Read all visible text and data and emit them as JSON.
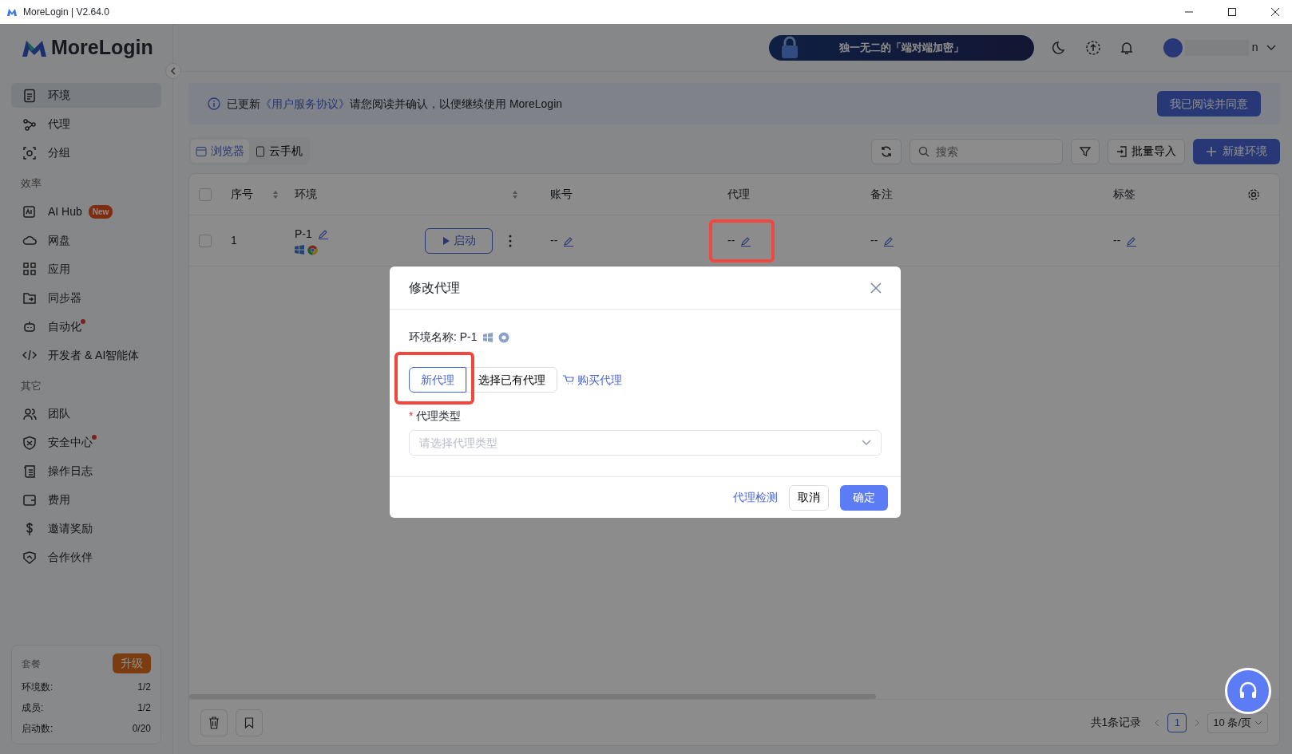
{
  "window": {
    "title": "MoreLogin | V2.64.0"
  },
  "sidebar": {
    "logo": "MoreLogin",
    "sections": [
      {
        "items": [
          {
            "label": "环境",
            "selected": true,
            "dot": false
          },
          {
            "label": "代理",
            "selected": false,
            "dot": false
          },
          {
            "label": "分组",
            "selected": false,
            "dot": false
          }
        ]
      },
      {
        "heading": "效率",
        "items": [
          {
            "label": "AI Hub",
            "selected": false,
            "dot": false,
            "badge": "New"
          },
          {
            "label": "网盘",
            "selected": false,
            "dot": false
          },
          {
            "label": "应用",
            "selected": false,
            "dot": false
          },
          {
            "label": "同步器",
            "selected": false,
            "dot": false
          },
          {
            "label": "自动化",
            "selected": false,
            "dot": true
          },
          {
            "label": "开发者 & AI智能体",
            "selected": false,
            "dot": false
          }
        ]
      },
      {
        "heading": "其它",
        "items": [
          {
            "label": "团队",
            "selected": false,
            "dot": false
          },
          {
            "label": "安全中心",
            "selected": false,
            "dot": true
          },
          {
            "label": "操作日志",
            "selected": false,
            "dot": false
          },
          {
            "label": "费用",
            "selected": false,
            "dot": false
          },
          {
            "label": "邀请奖励",
            "selected": false,
            "dot": false
          },
          {
            "label": "合作伙伴",
            "selected": false,
            "dot": false
          }
        ]
      }
    ],
    "plan": {
      "title": "套餐",
      "upgrade": "升级",
      "rows": [
        {
          "label": "环境数:",
          "value": "1/2"
        },
        {
          "label": "成员:",
          "value": "1/2"
        },
        {
          "label": "启动数:",
          "value": "0/20"
        }
      ]
    }
  },
  "header": {
    "banner": "独一无二的「端对端加密」",
    "user": "n"
  },
  "notice": {
    "text": "已更新",
    "link": "《用户服务协议》",
    "rest": "请您阅读并确认，以便继续使用 MoreLogin",
    "button": "我已阅读并同意"
  },
  "view_tabs": [
    {
      "label": "浏览器",
      "selected": true
    },
    {
      "label": "云手机",
      "selected": false
    }
  ],
  "toolbar": {
    "search": {
      "placeholder": "搜索"
    },
    "import": "批量导入",
    "create": "新建环境"
  },
  "table": {
    "all_selected": false,
    "columns": [
      "序号",
      "环境",
      "账号",
      "代理",
      "备注",
      "标签"
    ],
    "rows": [
      {
        "selected": false,
        "index": "1",
        "name": "P-1",
        "start": "启动",
        "account": "--",
        "proxy": "--",
        "proxy_highlighted": true,
        "note": "--",
        "tag": "--"
      }
    ]
  },
  "footer": {
    "total": "共1条记录",
    "pages": [
      {
        "label": "1",
        "selected": true
      }
    ],
    "page_size": "10 条/页"
  },
  "modal": {
    "title": "修改代理",
    "env_label": "环境名称: P-1",
    "tabs": [
      {
        "label": "新代理",
        "selected": true,
        "highlighted": true
      },
      {
        "label": "选择已有代理",
        "selected": false,
        "highlighted": false
      }
    ],
    "buy": "购买代理",
    "field": {
      "required_mark": "*",
      "label": "代理类型",
      "placeholder": "请选择代理类型"
    },
    "check": "代理检测",
    "cancel": "取消",
    "ok": "确定"
  }
}
